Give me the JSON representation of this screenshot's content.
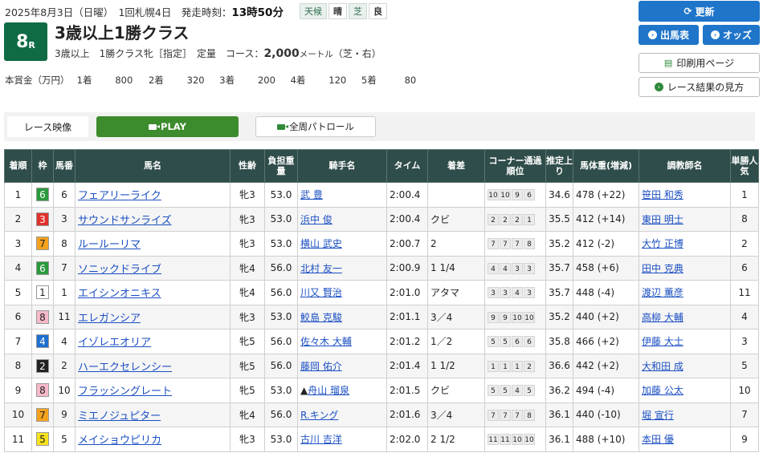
{
  "header": {
    "date_info": "2025年8月3日（日曜）　1回札幌4日　発走時刻：",
    "start_time": "13時50分",
    "weather_label": "天候",
    "weather_value": "晴",
    "track_label": "芝",
    "track_value": "良",
    "race_number": "8",
    "race_suffix": "R",
    "race_title": "3歳以上1勝クラス",
    "conditions": "3歳以上　1勝クラス牝［指定］　定量　コース：",
    "distance": "2,000",
    "distance_unit": "メートル",
    "course_type": "（芝・右）",
    "prize_label": "本賞金（万円）",
    "prizes": [
      {
        "place": "1着",
        "amount": "800"
      },
      {
        "place": "2着",
        "amount": "320"
      },
      {
        "place": "3着",
        "amount": "200"
      },
      {
        "place": "4着",
        "amount": "120"
      },
      {
        "place": "5着",
        "amount": "80"
      }
    ]
  },
  "buttons": {
    "update": "更新",
    "entries": "出馬表",
    "odds": "オッズ",
    "print": "印刷用ページ",
    "howto": "レース結果の見方"
  },
  "video": {
    "label": "レース映像",
    "play": "PLAY",
    "patrol": "全周パトロール"
  },
  "table": {
    "headers": [
      "着順",
      "枠",
      "馬番",
      "馬名",
      "性齢",
      "負担重量",
      "騎手名",
      "タイム",
      "着差",
      "コーナー通過順位",
      "推定上り",
      "馬体重(増減)",
      "調教師名",
      "単勝人気"
    ],
    "rows": [
      {
        "rank": "1",
        "waku": "6",
        "num": "6",
        "horse": "フェアリーライク",
        "sex": "牝3",
        "weight": "53.0",
        "jockey": "武 豊",
        "jmark": "",
        "time": "2:00.4",
        "margin": "",
        "corners": [
          "10",
          "10",
          "9",
          "6"
        ],
        "last3f": "34.6",
        "body": "478 (+22)",
        "trainer": "笹田 和秀",
        "pop": "1"
      },
      {
        "rank": "2",
        "waku": "3",
        "num": "3",
        "horse": "サウンドサンライズ",
        "sex": "牝3",
        "weight": "53.0",
        "jockey": "浜中 俊",
        "jmark": "",
        "time": "2:00.4",
        "margin": "クビ",
        "corners": [
          "2",
          "2",
          "2",
          "1"
        ],
        "last3f": "35.5",
        "body": "412 (+14)",
        "trainer": "東田 明士",
        "pop": "8"
      },
      {
        "rank": "3",
        "waku": "7",
        "num": "8",
        "horse": "ルールーリマ",
        "sex": "牝3",
        "weight": "53.0",
        "jockey": "横山 武史",
        "jmark": "",
        "time": "2:00.7",
        "margin": "2",
        "corners": [
          "7",
          "7",
          "7",
          "8"
        ],
        "last3f": "35.2",
        "body": "412 (-2)",
        "trainer": "大竹 正博",
        "pop": "2"
      },
      {
        "rank": "4",
        "waku": "6",
        "num": "7",
        "horse": "ソニックドライブ",
        "sex": "牝4",
        "weight": "56.0",
        "jockey": "北村 友一",
        "jmark": "",
        "time": "2:00.9",
        "margin": "1 1/4",
        "corners": [
          "4",
          "4",
          "3",
          "3"
        ],
        "last3f": "35.7",
        "body": "458 (+6)",
        "trainer": "田中 克典",
        "pop": "6"
      },
      {
        "rank": "5",
        "waku": "1",
        "num": "1",
        "horse": "エイシンオニキス",
        "sex": "牝4",
        "weight": "56.0",
        "jockey": "川又 賢治",
        "jmark": "",
        "time": "2:01.0",
        "margin": "アタマ",
        "corners": [
          "3",
          "3",
          "4",
          "3"
        ],
        "last3f": "35.7",
        "body": "448 (-4)",
        "trainer": "渡辺 薫彦",
        "pop": "11"
      },
      {
        "rank": "6",
        "waku": "8",
        "num": "11",
        "horse": "エレガンシア",
        "sex": "牝3",
        "weight": "53.0",
        "jockey": "鮫島 克駿",
        "jmark": "",
        "time": "2:01.1",
        "margin": "3／4",
        "corners": [
          "9",
          "9",
          "10",
          "10"
        ],
        "last3f": "35.2",
        "body": "440 (+2)",
        "trainer": "高柳 大輔",
        "pop": "4"
      },
      {
        "rank": "7",
        "waku": "4",
        "num": "4",
        "horse": "イゾレエオリア",
        "sex": "牝5",
        "weight": "56.0",
        "jockey": "佐々木 大輔",
        "jmark": "",
        "time": "2:01.2",
        "margin": "1／2",
        "corners": [
          "5",
          "5",
          "6",
          "6"
        ],
        "last3f": "35.8",
        "body": "466 (+2)",
        "trainer": "伊藤 大士",
        "pop": "3"
      },
      {
        "rank": "8",
        "waku": "2",
        "num": "2",
        "horse": "ハーエクセレンシー",
        "sex": "牝5",
        "weight": "56.0",
        "jockey": "藤岡 佑介",
        "jmark": "",
        "time": "2:01.4",
        "margin": "1 1/2",
        "corners": [
          "1",
          "1",
          "1",
          "2"
        ],
        "last3f": "36.6",
        "body": "442 (+2)",
        "trainer": "大和田 成",
        "pop": "5"
      },
      {
        "rank": "9",
        "waku": "8",
        "num": "10",
        "horse": "フラッシングレート",
        "sex": "牝5",
        "weight": "53.0",
        "jockey": "舟山 瑠泉",
        "jmark": "▲",
        "time": "2:01.5",
        "margin": "クビ",
        "corners": [
          "5",
          "5",
          "4",
          "5"
        ],
        "last3f": "36.2",
        "body": "494 (-4)",
        "trainer": "加藤 公太",
        "pop": "10"
      },
      {
        "rank": "10",
        "waku": "7",
        "num": "9",
        "horse": "ミエノジュピター",
        "sex": "牝4",
        "weight": "56.0",
        "jockey": "R.キング",
        "jmark": "",
        "time": "2:01.6",
        "margin": "3／4",
        "corners": [
          "7",
          "7",
          "7",
          "8"
        ],
        "last3f": "36.1",
        "body": "440 (-10)",
        "trainer": "堀 宣行",
        "pop": "7"
      },
      {
        "rank": "11",
        "waku": "5",
        "num": "5",
        "horse": "メイショウピリカ",
        "sex": "牝3",
        "weight": "53.0",
        "jockey": "古川 吉洋",
        "jmark": "",
        "time": "2:02.0",
        "margin": "2 1/2",
        "corners": [
          "11",
          "11",
          "10",
          "10"
        ],
        "last3f": "36.1",
        "body": "488 (+10)",
        "trainer": "本田 優",
        "pop": "9"
      }
    ]
  },
  "colors": {
    "waku": {
      "1": {
        "bg": "#ffffff",
        "fg": "#222222"
      },
      "2": {
        "bg": "#222222",
        "fg": "#ffffff"
      },
      "3": {
        "bg": "#e0312b",
        "fg": "#ffffff"
      },
      "4": {
        "bg": "#1e6fd0",
        "fg": "#ffffff"
      },
      "5": {
        "bg": "#f6e11d",
        "fg": "#222222"
      },
      "6": {
        "bg": "#2a9a3c",
        "fg": "#ffffff"
      },
      "7": {
        "bg": "#f4a21d",
        "fg": "#222222"
      },
      "8": {
        "bg": "#f6b9c9",
        "fg": "#222222"
      }
    }
  }
}
